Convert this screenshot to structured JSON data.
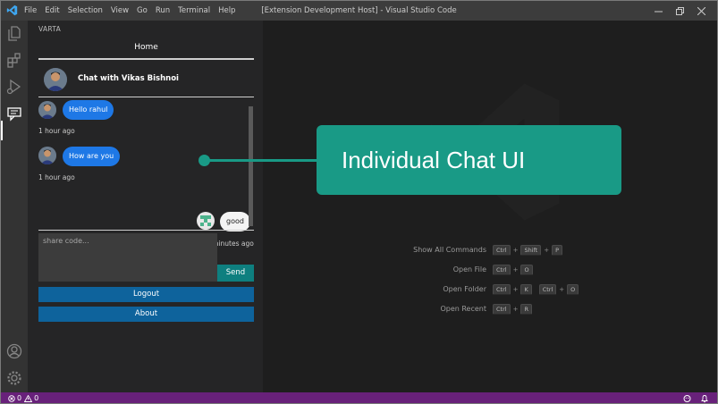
{
  "window": {
    "title": "[Extension Development Host] - Visual Studio Code",
    "menu": [
      "File",
      "Edit",
      "Selection",
      "View",
      "Go",
      "Run",
      "Terminal",
      "Help"
    ]
  },
  "sidebar": {
    "title": "VARTA",
    "home_label": "Home",
    "chat_title": "Chat with Vikas Bishnoi",
    "messages": [
      {
        "text": "Hello rahul",
        "time": "1 hour ago",
        "side": "left"
      },
      {
        "text": "How are you",
        "time": "1 hour ago",
        "side": "left"
      },
      {
        "text": "good",
        "time": "5 minutes ago",
        "side": "right"
      }
    ],
    "input_placeholder": "share code...",
    "send_label": "Send",
    "logout_label": "Logout",
    "about_label": "About"
  },
  "editor": {
    "shortcuts": [
      {
        "label": "Show All Commands",
        "keys": [
          [
            "Ctrl",
            "Shift",
            "P"
          ]
        ]
      },
      {
        "label": "Open File",
        "keys": [
          [
            "Ctrl",
            "O"
          ]
        ]
      },
      {
        "label": "Open Folder",
        "keys": [
          [
            "Ctrl",
            "K"
          ],
          [
            "Ctrl",
            "O"
          ]
        ]
      },
      {
        "label": "Open Recent",
        "keys": [
          [
            "Ctrl",
            "R"
          ]
        ]
      }
    ]
  },
  "callout": {
    "text": "Individual Chat UI"
  },
  "statusbar": {
    "errors": "0",
    "warnings": "0"
  },
  "colors": {
    "accent": "#199a86",
    "statusbar": "#68217a",
    "bubble": "#1e78e6",
    "button": "#0e639c"
  }
}
